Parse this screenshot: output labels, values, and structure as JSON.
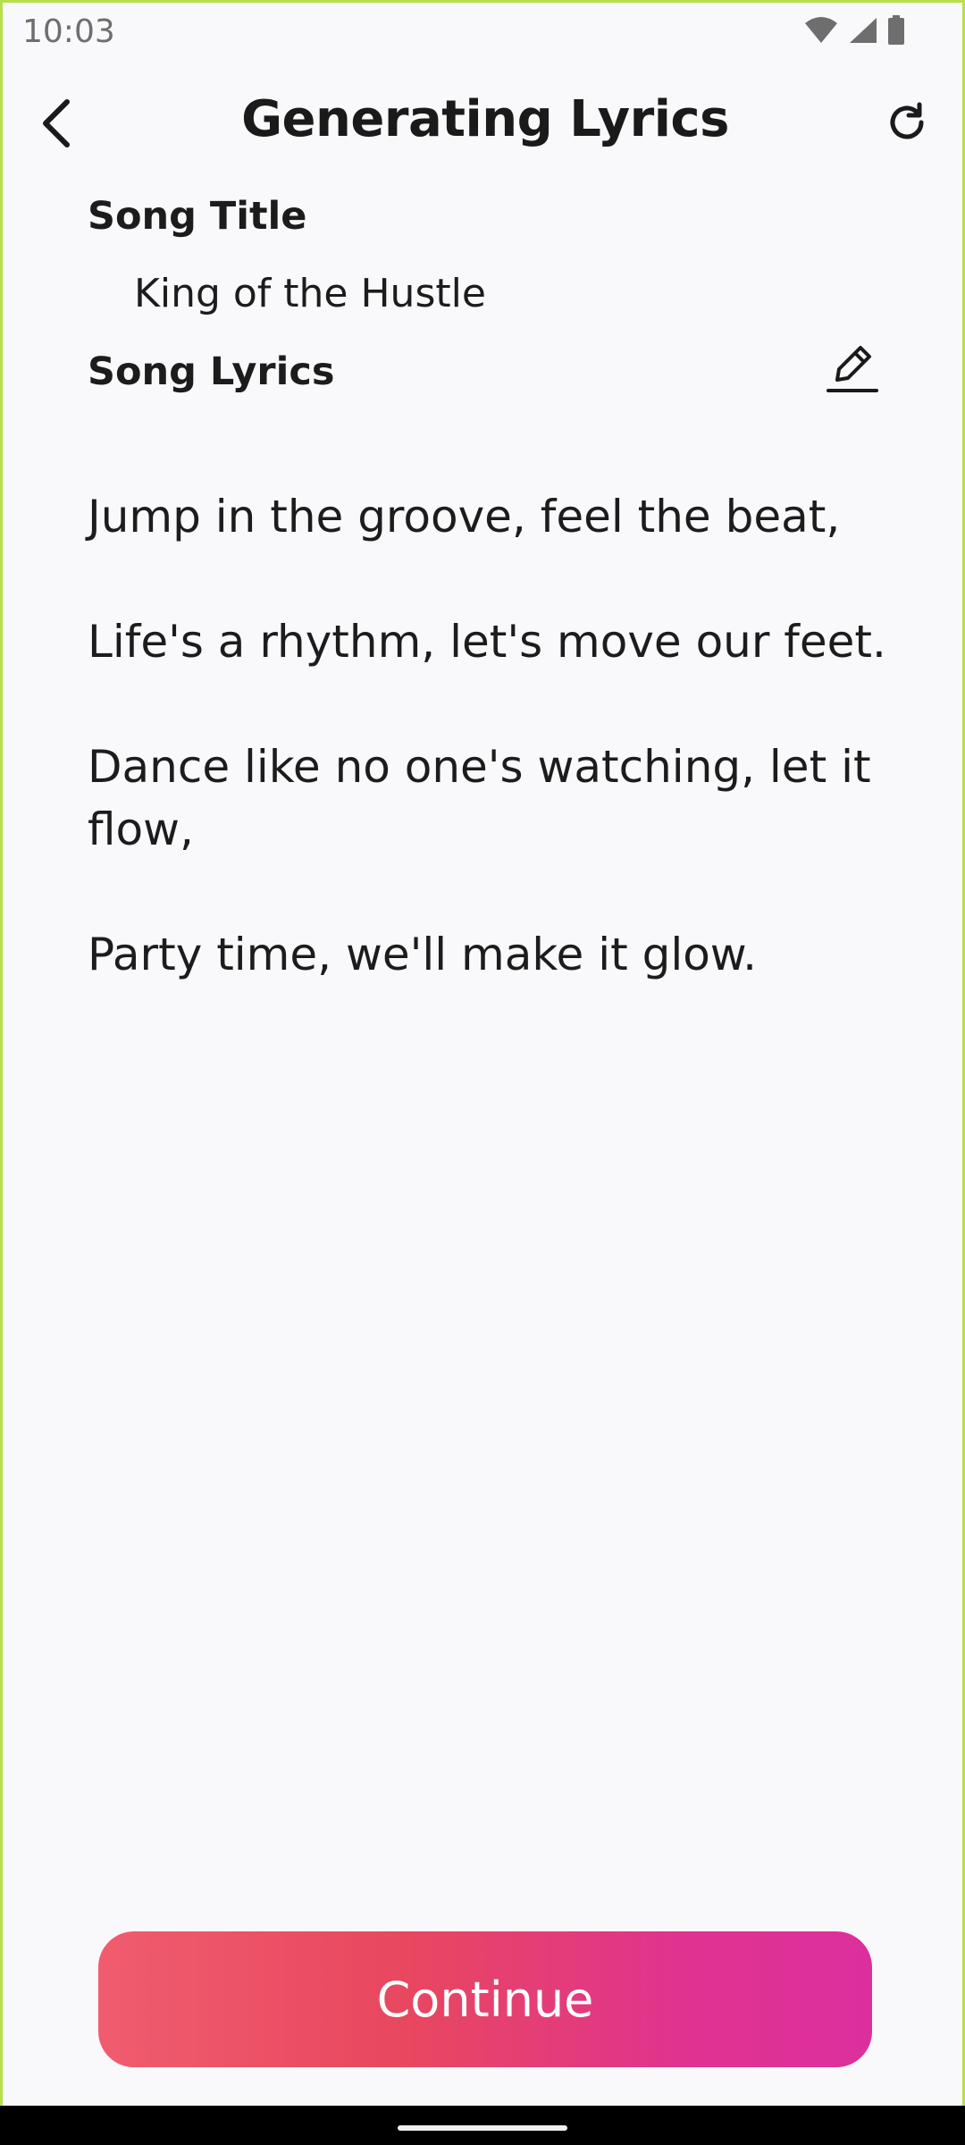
{
  "status_bar": {
    "time": "10:03",
    "icons": [
      "wifi-icon",
      "signal-icon",
      "battery-icon"
    ]
  },
  "header": {
    "title": "Generating Lyrics",
    "back_icon": "chevron-left-icon",
    "refresh_icon": "refresh-icon"
  },
  "song": {
    "title_label": "Song Title",
    "title_value": "King of the Hustle",
    "lyrics_label": "Song Lyrics",
    "edit_icon": "pencil-icon",
    "lyrics_lines": [
      "Jump in the groove, feel the beat,",
      "Life's a rhythm, let's move our feet.",
      "Dance like no one's watching, let it flow,",
      "Party time, we'll make it glow."
    ]
  },
  "actions": {
    "continue_label": "Continue"
  },
  "colors": {
    "background": "#f9f9fb",
    "frame_border": "#b7e04a",
    "button_gradient_start": "#f05c6f",
    "button_gradient_end": "#dc2f9e"
  }
}
